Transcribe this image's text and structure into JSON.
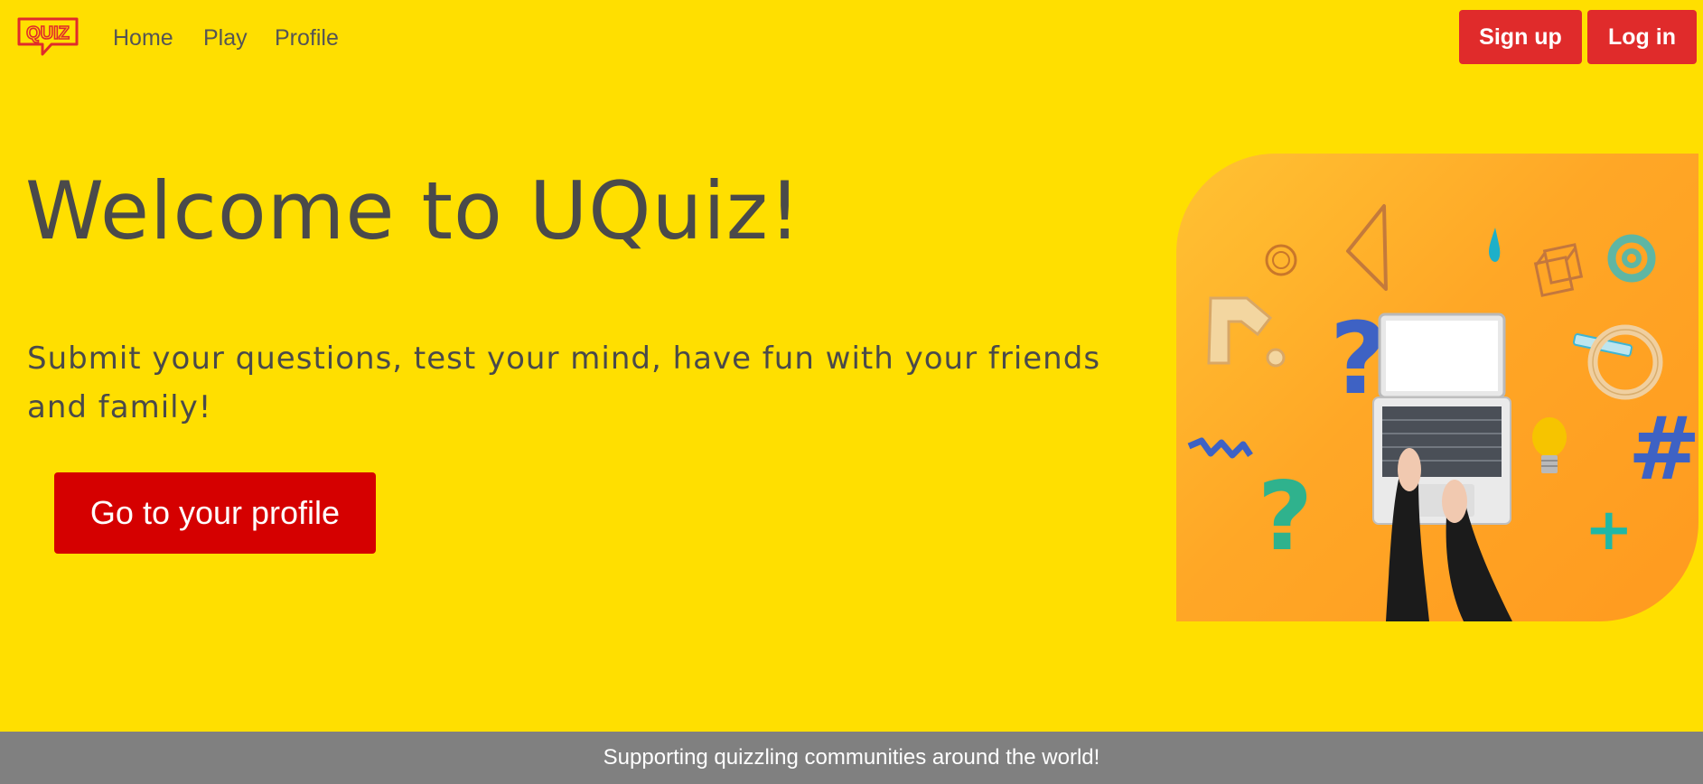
{
  "brand": {
    "logo_text": "QUIZ",
    "colors": {
      "background": "#ffdf00",
      "accent": "#e02b2b",
      "cta": "#d50000",
      "footer": "#808080"
    }
  },
  "nav": {
    "links": [
      {
        "label": "Home"
      },
      {
        "label": "Play"
      },
      {
        "label": "Profile"
      }
    ]
  },
  "auth": {
    "signup_label": "Sign up",
    "login_label": "Log in"
  },
  "hero": {
    "title": "Welcome to UQuiz!",
    "subtitle": "Submit your questions, test your mind, have fun with your friends and family!",
    "cta_label": "Go to your profile"
  },
  "illustration": {
    "icons": [
      "question-mark-icon",
      "laptop-icon",
      "at-sign-icon",
      "hashtag-icon",
      "lightbulb-icon",
      "plus-icon",
      "ring-icon",
      "triangle-icon",
      "cube-icon",
      "drop-icon",
      "zigzag-icon"
    ]
  },
  "footer": {
    "text": "Supporting quizzling communities around the world!"
  }
}
